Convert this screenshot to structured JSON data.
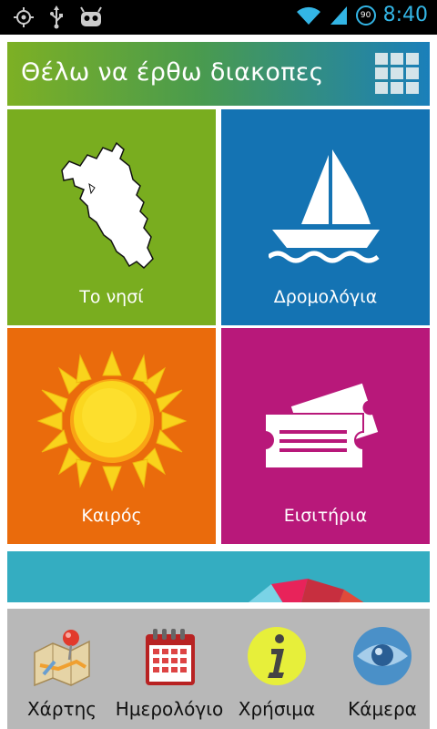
{
  "status_bar": {
    "battery_level": "90",
    "time": "8:40",
    "accent_color": "#33b5e5",
    "left_icons": [
      "gps-icon",
      "usb-icon",
      "android-robot-icon"
    ],
    "right_icons": [
      "wifi-icon",
      "signal-icon",
      "battery-icon"
    ]
  },
  "header": {
    "title": "Θέλω να έρθω διακοπες",
    "menu_icon": "grid-menu-icon"
  },
  "tiles": [
    {
      "label": "Το νησί",
      "icon": "island-map-icon",
      "color": "#79ad1f"
    },
    {
      "label": "Δρομολόγια",
      "icon": "sailboat-icon",
      "color": "#1473b3"
    },
    {
      "label": "Καιρός",
      "icon": "sun-icon",
      "color": "#ea6b0c"
    },
    {
      "label": "Εισιτήρια",
      "icon": "tickets-icon",
      "color": "#b8187a"
    }
  ],
  "banner": {
    "icon": "umbrella-icon",
    "color": "#34adc1"
  },
  "bottom_nav": [
    {
      "label": "Χάρτης",
      "icon": "map-pin-icon"
    },
    {
      "label": "Ημερολόγιο",
      "icon": "calendar-icon"
    },
    {
      "label": "Χρήσιμα",
      "icon": "info-icon"
    },
    {
      "label": "Κάμερα",
      "icon": "eye-icon"
    }
  ]
}
